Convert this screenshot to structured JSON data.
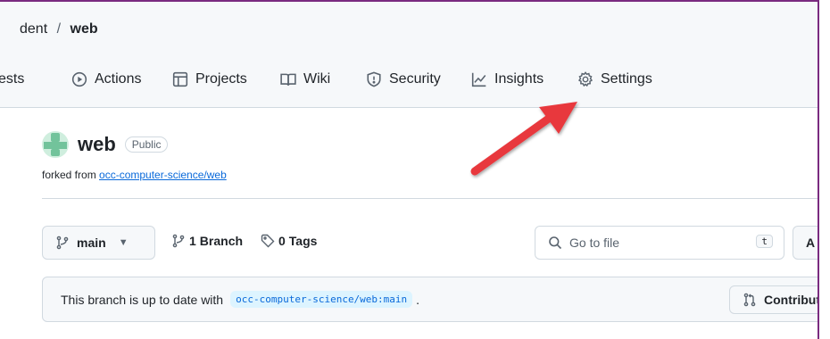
{
  "breadcrumb": {
    "owner": "dent",
    "separator": "/",
    "repo": "web"
  },
  "tabs": [
    {
      "label": "ests",
      "icon": ""
    },
    {
      "label": "Actions",
      "icon": "play-circle-icon"
    },
    {
      "label": "Projects",
      "icon": "table-icon"
    },
    {
      "label": "Wiki",
      "icon": "book-icon"
    },
    {
      "label": "Security",
      "icon": "shield-icon"
    },
    {
      "label": "Insights",
      "icon": "graph-icon"
    },
    {
      "label": "Settings",
      "icon": "gear-icon"
    }
  ],
  "repo": {
    "name": "web",
    "visibility": "Public",
    "forked_prefix": "forked from",
    "forked_link": "occ-computer-science/web"
  },
  "toolbar": {
    "branch": "main",
    "branches_count": "1",
    "branches_label": "Branch",
    "tags_count": "0",
    "tags_label": "Tags",
    "search_placeholder": "Go to file",
    "search_shortcut": "t",
    "add_label": "A"
  },
  "status": {
    "text": "This branch is up to date with",
    "ref": "occ-computer-science/web:main",
    "suffix": ".",
    "contribute_label": "Contribute"
  },
  "colors": {
    "accent": "#0969da",
    "arrow": "#e8383d",
    "frame": "#7a2b80"
  }
}
